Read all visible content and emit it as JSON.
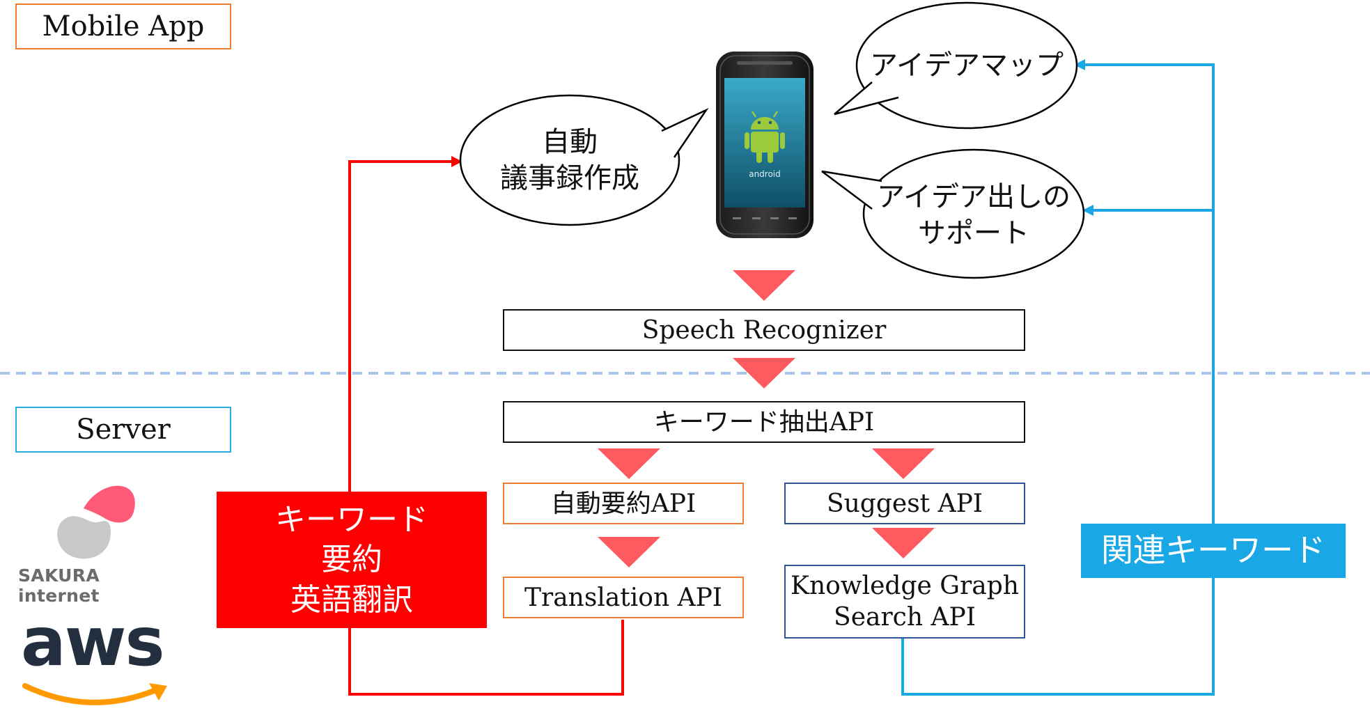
{
  "layers": {
    "mobile": "Mobile App",
    "server": "Server"
  },
  "bubbles": {
    "minutes": "自動\n議事録作成",
    "idea_map": "アイデアマップ",
    "idea_support": "アイデア出しの\nサポート"
  },
  "apis": {
    "speech": "Speech Recognizer",
    "keyword_extract": "キーワード抽出API",
    "auto_summary": "自動要約API",
    "translation": "Translation API",
    "suggest": "Suggest API",
    "knowledge_graph": "Knowledge Graph\nSearch API"
  },
  "callouts": {
    "left": "キーワード\n要約\n英語翻訳",
    "right": "関連キーワード"
  },
  "logos": {
    "sakura": "SAKURA internet",
    "aws": "aws",
    "phone_os": "android"
  },
  "colors": {
    "mobile_label_border": "#ED7D31",
    "server_label_border": "#29ABE2",
    "flow_triangle": "#FF5A5F",
    "red_line": "#FF0000",
    "blue_line": "#1AA7E6",
    "blue_box_border": "#2F5597",
    "orange_box_border": "#ED7D31",
    "divider": "#A9C4EA"
  },
  "icons": {
    "phone": "android-phone-icon",
    "sakura_logo": "sakura-logo-icon",
    "aws_logo": "aws-logo-icon"
  }
}
